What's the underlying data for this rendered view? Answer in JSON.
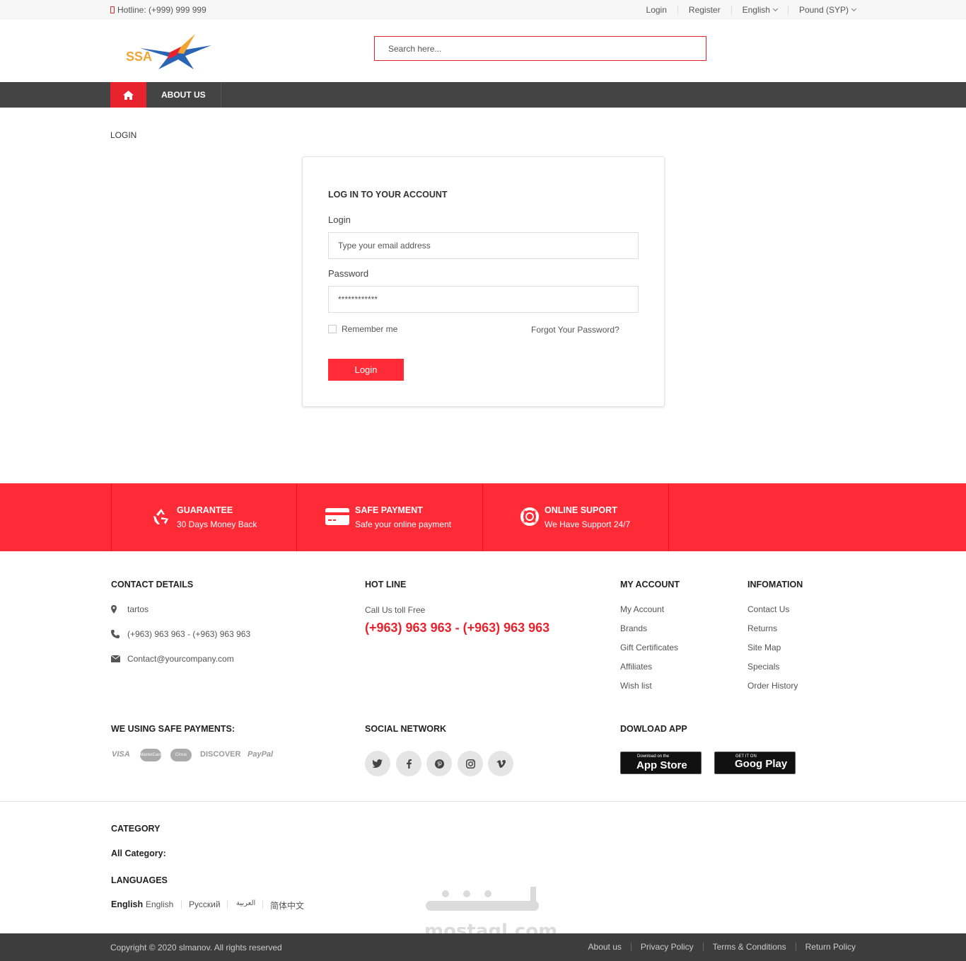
{
  "topbar": {
    "hotline": "Hotline: (+999) 999 999",
    "login": "Login",
    "register": "Register",
    "language": "English",
    "currency": "Pound (SYP)"
  },
  "header": {
    "logo_text": "SSA",
    "search_placeholder": "Search here..."
  },
  "nav": {
    "about": "ABOUT US"
  },
  "breadcrumb": "LOGIN",
  "login_form": {
    "title": "LOG IN TO YOUR ACCOUNT",
    "login_label": "Login",
    "email_placeholder": "Type your email address",
    "password_label": "Password",
    "password_value": "************",
    "remember": "Remember me",
    "forgot": "Forgot Your Password?",
    "button": "Login"
  },
  "features": [
    {
      "title": "GUARANTEE",
      "sub": "30 Days Money Back",
      "icon": "recycle-icon"
    },
    {
      "title": "SAFE PAYMENT",
      "sub": "Safe your online payment",
      "icon": "credit-card-icon"
    },
    {
      "title": "ONLINE SUPORT",
      "sub": "We Have Support 24/7",
      "icon": "lifebuoy-icon"
    }
  ],
  "footer": {
    "contact_title": "CONTACT DETAILS",
    "contact_address": "tartos",
    "contact_phone": "(+963) 963 963 - (+963) 963 963",
    "contact_email": "Contact@yourcompany.com",
    "hotline_title": "HOT LINE",
    "hotline_sub": "Call Us toll Free",
    "hotline_number": "(+963) 963 963 - (+963) 963 963",
    "account_title": "MY ACCOUNT",
    "account_links": [
      "My Account",
      "Brands",
      "Gift Certificates",
      "Affiliates",
      "Wish list"
    ],
    "info_title": "INFOMATION",
    "info_links": [
      "Contact Us",
      "Returns",
      "Site Map",
      "Specials",
      "Order History"
    ],
    "payments_title": "WE USING SAFE PAYMENTS:",
    "payments": [
      "VISA",
      "MasterCard",
      "Cirrus",
      "DISCOVER",
      "PayPal"
    ],
    "social_title": "SOCIAL NETWORK",
    "social": [
      "twitter-icon",
      "facebook-icon",
      "pinterest-icon",
      "instagram-icon",
      "vimeo-icon"
    ],
    "app_title": "DOWLOAD APP",
    "appstore_small": "Download on the",
    "appstore_big": "App Store",
    "googleplay_small": "GET IT ON",
    "googleplay_big": "Goog Play",
    "category_title": "CATEGORY",
    "all_category": "All Category:",
    "languages_title": "LANGUAGES",
    "languages_label": "English",
    "languages": [
      "English",
      "Русский",
      "العربية",
      "简体中文"
    ]
  },
  "watermark": "mostaql.com",
  "bottom": {
    "copyright": "Copyright © 2020 slmanov. All rights reserved",
    "links": [
      "About us",
      "Privacy Policy",
      "Terms & Conditions",
      "Return Policy"
    ]
  },
  "colors": {
    "accent": "#ff2b37",
    "nav_bg": "#444444",
    "bottom_bg": "#3d3d3d"
  }
}
